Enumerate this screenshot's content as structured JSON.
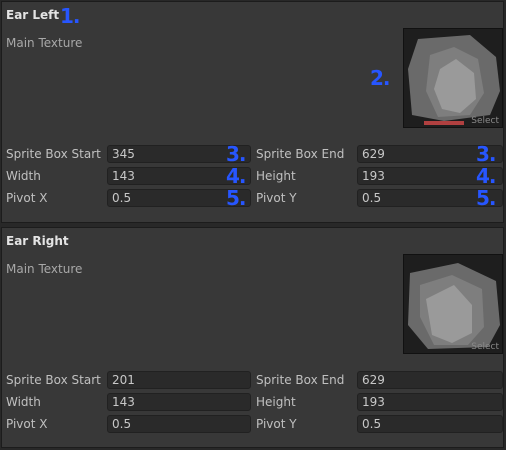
{
  "panels": [
    {
      "title": "Ear Left",
      "texture_label": "Main Texture",
      "select_label": "Select",
      "fields": {
        "sprite_box_start": {
          "label": "Sprite Box Start",
          "value": "345"
        },
        "sprite_box_end": {
          "label": "Sprite Box End",
          "value": "629"
        },
        "width": {
          "label": "Width",
          "value": "143"
        },
        "height": {
          "label": "Height",
          "value": "193"
        },
        "pivot_x": {
          "label": "Pivot X",
          "value": "0.5"
        },
        "pivot_y": {
          "label": "Pivot Y",
          "value": "0.5"
        }
      }
    },
    {
      "title": "Ear Right",
      "texture_label": "Main Texture",
      "select_label": "Select",
      "fields": {
        "sprite_box_start": {
          "label": "Sprite Box Start",
          "value": "201"
        },
        "sprite_box_end": {
          "label": "Sprite Box End",
          "value": "629"
        },
        "width": {
          "label": "Width",
          "value": "143"
        },
        "height": {
          "label": "Height",
          "value": "193"
        },
        "pivot_x": {
          "label": "Pivot X",
          "value": "0.5"
        },
        "pivot_y": {
          "label": "Pivot Y",
          "value": "0.5"
        }
      }
    }
  ],
  "annotations": {
    "n1": "1.",
    "n2": "2.",
    "n3": "3.",
    "n4": "4.",
    "n5": "5."
  },
  "colors": {
    "annotation": "#2756ff",
    "panel_bg": "#383838",
    "field_bg": "#2a2a2a"
  }
}
